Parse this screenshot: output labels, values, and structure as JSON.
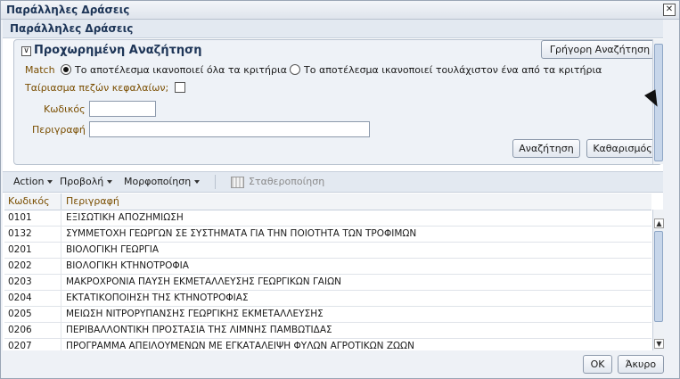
{
  "window": {
    "title": "Παράλληλες Δράσεις",
    "close_symbol": "✕"
  },
  "content": {
    "title": "Παράλληλες Δράσεις"
  },
  "advanced_search": {
    "toggle_symbol": "∨",
    "title": "Προχωρημένη Αναζήτηση",
    "quick_button": "Γρήγορη Αναζήτηση",
    "match_label": "Match",
    "match_all": "Το αποτέλεσμα ικανοποιεί όλα τα κριτήρια",
    "match_any": "Το αποτέλεσμα ικανοποιεί τουλάχιστον ένα από τα κριτήρια",
    "match_selected": "all",
    "case_label": "Ταίριασμα πεζών κεφαλαίων;",
    "code_label": "Κωδικός",
    "code_value": "",
    "desc_label": "Περιγραφή",
    "desc_value": "",
    "search_button": "Αναζήτηση",
    "clear_button": "Καθαρισμός"
  },
  "toolbar": {
    "action": "Action",
    "view": "Προβολή",
    "format": "Μορφοποίηση",
    "freeze": "Σταθεροποίηση"
  },
  "table": {
    "headers": [
      "Κωδικός",
      "Περιγραφή"
    ],
    "rows": [
      {
        "code": "0101",
        "desc": "ΕΞΙΣΩΤΙΚΗ ΑΠΟΖΗΜΙΩΣΗ"
      },
      {
        "code": "0132",
        "desc": "ΣΥΜΜΕΤΟΧΗ ΓΕΩΡΓΩΝ ΣΕ ΣΥΣΤΗΜΑΤΑ ΓΙΑ ΤΗΝ ΠΟΙΟΤΗΤΑ ΤΩΝ ΤΡΟΦΙΜΩΝ"
      },
      {
        "code": "0201",
        "desc": "ΒΙΟΛΟΓΙΚΗ ΓΕΩΡΓΙΑ"
      },
      {
        "code": "0202",
        "desc": "ΒΙΟΛΟΓΙΚΗ ΚΤΗΝΟΤΡΟΦΙΑ"
      },
      {
        "code": "0203",
        "desc": "ΜΑΚΡΟΧΡΟΝΙΑ ΠΑΥΣΗ ΕΚΜΕΤΑΛΛΕΥΣΗΣ ΓΕΩΡΓΙΚΩΝ ΓΑΙΩΝ"
      },
      {
        "code": "0204",
        "desc": "ΕΚΤΑΤΙΚΟΠΟΙΗΣΗ ΤΗΣ ΚΤΗΝΟΤΡΟΦΙΑΣ"
      },
      {
        "code": "0205",
        "desc": "ΜΕΙΩΣΗ ΝΙΤΡΟΡΥΠΑΝΣΗΣ ΓΕΩΡΓΙΚΗΣ ΕΚΜΕΤΑΛΛΕΥΣΗΣ"
      },
      {
        "code": "0206",
        "desc": "ΠΕΡΙΒΑΛΛΟΝΤΙΚΗ ΠΡΟΣΤΑΣΙΑ ΤΗΣ ΛΙΜΝΗΣ ΠΑΜΒΩΤΙΔΑΣ"
      },
      {
        "code": "0207",
        "desc": "ΠΡΟΓΡΑΜΜΑ ΑΠΕΙΛΟΥΜΕΝΩΝ ΜΕ ΕΓΚΑΤΑΛΕΙΨΗ ΦΥΛΩΝ ΑΓΡΟΤΙΚΩΝ ΖΩΩΝ"
      }
    ]
  },
  "footer": {
    "ok": "OK",
    "cancel": "Άκυρο"
  },
  "colors": {
    "label": "#7a4e00",
    "heading": "#1d3557",
    "panel": "#eef2f7"
  }
}
